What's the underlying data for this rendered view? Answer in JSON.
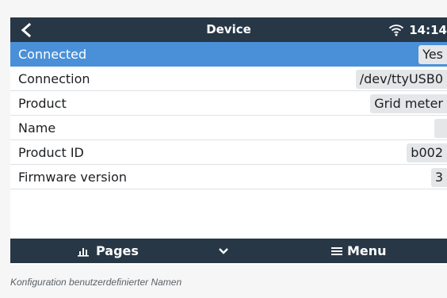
{
  "titlebar": {
    "back_icon": "chevron-left-icon",
    "title": "Device",
    "wifi_icon": "wifi-icon",
    "time": "14:14"
  },
  "rows": [
    {
      "label": "Connected",
      "value": "Yes"
    },
    {
      "label": "Connection",
      "value": "/dev/ttyUSB0"
    },
    {
      "label": "Product",
      "value": "Grid meter"
    },
    {
      "label": "Name",
      "value": ""
    },
    {
      "label": "Product ID",
      "value": "b002"
    },
    {
      "label": "Firmware version",
      "value": "3"
    }
  ],
  "bottombar": {
    "pages_icon": "bar-chart-icon",
    "pages_label": "Pages",
    "toggle_icon": "chevron-down-icon",
    "menu_icon": "hamburger-menu-icon",
    "menu_label": "Menu"
  },
  "caption": "Konfiguration benutzerdefinierter Namen",
  "colors": {
    "bar_bg": "#273746",
    "selected_row": "#4a90d9",
    "value_bg": "#e4e6e8",
    "page_bg": "#f6f6f6"
  }
}
